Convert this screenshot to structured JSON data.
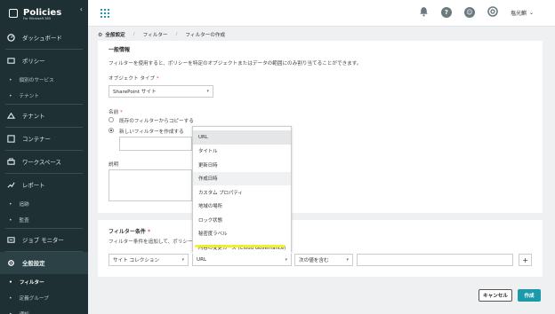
{
  "brand": {
    "title": "Policies",
    "subtitle": "For Microsoft 365"
  },
  "sidebar": {
    "items": [
      {
        "label": "ダッシュボード",
        "icon": "dashboard-icon"
      },
      {
        "label": "ポリシー",
        "icon": "policy-icon"
      },
      {
        "label": "個別のサービス",
        "sub": true
      },
      {
        "label": "テナント",
        "sub": true
      },
      {
        "label": "テナント",
        "icon": "tenant-icon"
      },
      {
        "label": "コンテナー",
        "icon": "container-icon"
      },
      {
        "label": "ワークスペース",
        "icon": "workspace-icon"
      },
      {
        "label": "レポート",
        "icon": "report-icon"
      },
      {
        "label": "追跡",
        "sub": true
      },
      {
        "label": "監査",
        "sub": true
      },
      {
        "label": "ジョブ モニター",
        "icon": "job-monitor-icon"
      },
      {
        "label": "全般設定",
        "icon": "settings-icon"
      },
      {
        "label": "フィルター",
        "sub": true
      },
      {
        "label": "定義グループ",
        "sub": true
      },
      {
        "label": "通知",
        "sub": true
      }
    ]
  },
  "topbar": {
    "user": "塩光麒"
  },
  "breadcrumb": {
    "home": "全般設定",
    "level1": "フィルター",
    "current": "フィルターの作成"
  },
  "general": {
    "title": "一般情報",
    "description": "フィルターを使用すると、ポリシーを特定のオブジェクトまたはデータの範囲にのみ割り当てることができます。",
    "object_type_label": "オブジェクト タイプ",
    "object_type_value": "SharePoint サイト",
    "name_label": "名前",
    "radio_import": "既存のフィルターからコピーする",
    "radio_new": "新しいフィルターを作成する",
    "description_label": "説明"
  },
  "dropdown": {
    "items": [
      "URL",
      "タイトル",
      "更新日時",
      "作成日時",
      "カスタム プロパティ",
      "地域の場所",
      "ロック状態",
      "秘密度ラベル",
      "内容の変更カーズ (Cloud Governance)"
    ]
  },
  "conditions": {
    "title": "フィルター条件",
    "description": "フィルター条件を追加して、ポリシーを特定の",
    "field1": "サイト コレクション",
    "field2": "URL",
    "operator": "次の値を含む",
    "plus": "+"
  },
  "actions": {
    "cancel": "キャンセル",
    "create": "作成"
  },
  "colors": {
    "sidebar": "#1f3034",
    "accent": "#1d9aa9",
    "highlight": "#f3f316"
  }
}
